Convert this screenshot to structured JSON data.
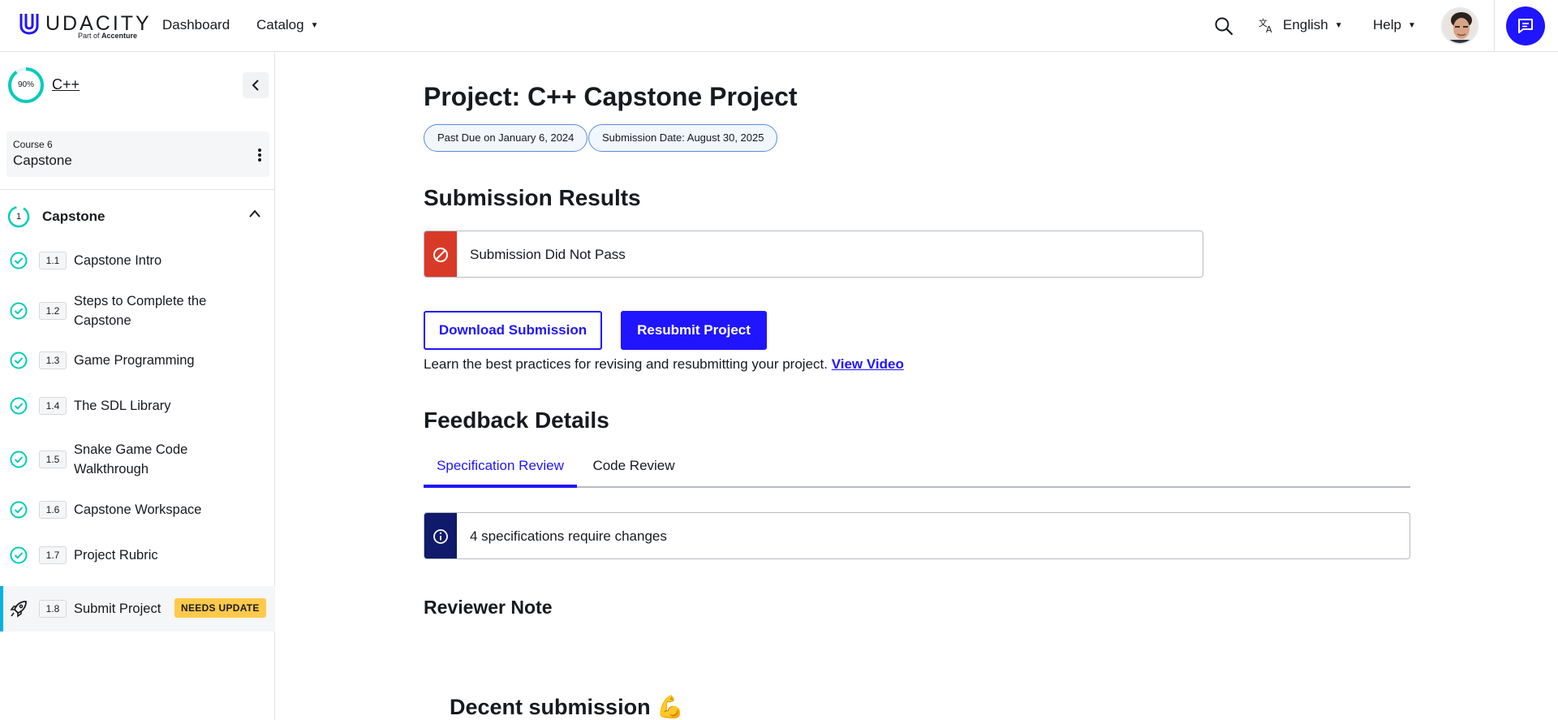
{
  "header": {
    "logo_text": "UDACITY",
    "logo_sub_prefix": "Part of",
    "logo_sub_brand": "Accenture",
    "nav": {
      "dashboard": "Dashboard",
      "catalog": "Catalog"
    },
    "language": "English",
    "help": "Help",
    "icons": {
      "search": "search-icon",
      "translate": "translate-icon",
      "chat": "chat-icon"
    }
  },
  "sidebar": {
    "progress_percent_label": "90%",
    "progress": 0.9,
    "course_name": "C++",
    "course_card": {
      "label": "Course 6",
      "title": "Capstone"
    },
    "lesson": {
      "number": "1",
      "title": "Capstone"
    },
    "concepts": [
      {
        "number": "1.1",
        "title": "Capstone Intro",
        "status": "complete"
      },
      {
        "number": "1.2",
        "title": "Steps to Complete the Capstone",
        "status": "complete"
      },
      {
        "number": "1.3",
        "title": "Game Programming",
        "status": "complete"
      },
      {
        "number": "1.4",
        "title": "The SDL Library",
        "status": "complete"
      },
      {
        "number": "1.5",
        "title": "Snake Game Code Walkthrough",
        "status": "complete"
      },
      {
        "number": "1.6",
        "title": "Capstone Workspace",
        "status": "complete"
      },
      {
        "number": "1.7",
        "title": "Project Rubric",
        "status": "complete"
      },
      {
        "number": "1.8",
        "title": "Submit Project",
        "status": "active",
        "badge": "NEEDS UPDATE"
      }
    ]
  },
  "main": {
    "title": "Project: C++ Capstone Project",
    "pills": {
      "due": "Past Due on January 6, 2024",
      "submission": "Submission Date: August 30, 2025"
    },
    "results_heading": "Submission Results",
    "result_status": "Submission Did Not Pass",
    "buttons": {
      "download": "Download Submission",
      "resubmit": "Resubmit Project"
    },
    "hint_text": "Learn the best practices for revising and resubmitting your project.",
    "hint_link": "View Video",
    "feedback_heading": "Feedback Details",
    "tabs": {
      "spec": "Specification Review",
      "code": "Code Review"
    },
    "spec_alert": "4 specifications require changes",
    "reviewer_note_heading": "Reviewer Note",
    "reviewer_note_title": "Decent submission 💪"
  },
  "colors": {
    "accent": "#2015ff",
    "teal": "#02ccba",
    "error": "#d93a28",
    "info": "#0f1a6b",
    "badge": "#ffc94b"
  }
}
